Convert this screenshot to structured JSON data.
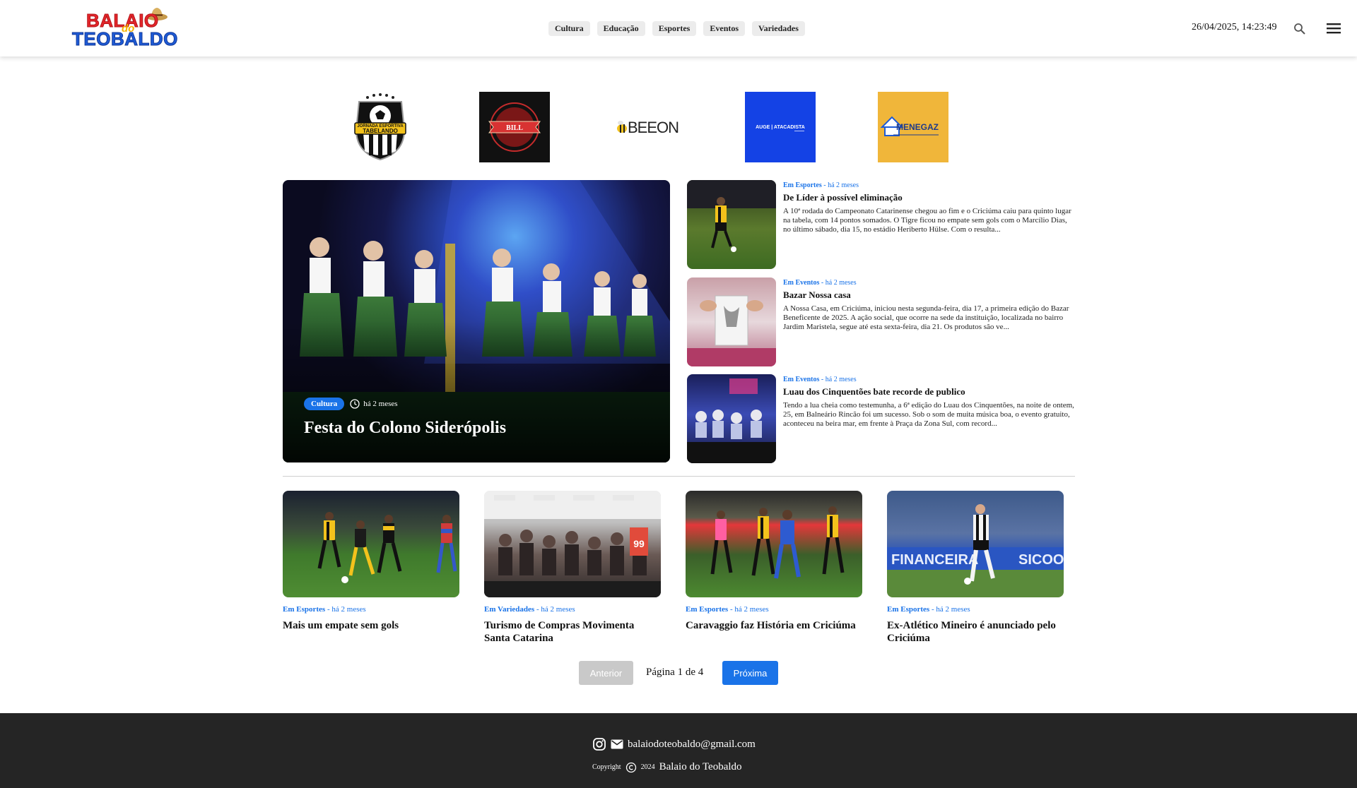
{
  "header": {
    "logo_top": "BALAIO",
    "logo_do": "do",
    "logo_bottom": "TEOBALDO",
    "nav": [
      "Cultura",
      "Educação",
      "Esportes",
      "Eventos",
      "Variedades"
    ],
    "datetime": "26/04/2025, 14:23:49",
    "icons": {
      "search": "search-icon",
      "menu": "menu-icon"
    }
  },
  "sponsors": {
    "tabelando": {
      "line1": "JORNADA ESPORTIVA",
      "line2": "TABELANDO"
    },
    "bill": {
      "name": "BILL"
    },
    "beeon": {
      "name": "BEEON"
    },
    "auge": {
      "name": "AUGE | ATACADISTA"
    },
    "menegaz": {
      "name": "MENEGAZ"
    }
  },
  "featured": {
    "category": "Cultura",
    "time": "há 2 meses",
    "title": "Festa do Colono Siderópolis"
  },
  "side_articles": [
    {
      "prefix": "Em Esportes",
      "time": "há 2 meses",
      "title": "De Líder à possível eliminação",
      "excerpt": "A 10ª rodada do Campeonato Catarinense chegou ao fim e o Criciúma caiu para quinto lugar na tabela, com 14 pontos somados. O Tigre ficou no empate sem gols com o Marcílio Dias, no último sábado, dia 15, no estádio Heriberto Hülse. Com o resulta..."
    },
    {
      "prefix": "Em Eventos",
      "time": "há 2 meses",
      "title": "Bazar Nossa casa",
      "excerpt": "A Nossa Casa, em Criciúma, iniciou nesta segunda-feira, dia 17, a primeira edição do Bazar Beneficente de 2025. A ação social, que ocorre na sede da instituição, localizada no bairro Jardim Maristela, segue até esta sexta-feira, dia 21. Os produtos são ve..."
    },
    {
      "prefix": "Em Eventos",
      "time": "há 2 meses",
      "title": "Luau dos Cinquentões bate recorde de publico",
      "excerpt": "Tendo a lua cheia como testemunha, a 6ª edição do Luau dos Cinquentões, na noite de ontem, 25, em Balneário Rincão foi um sucesso. Sob o som de muita música boa, o evento gratuito, aconteceu na beira mar, em frente à Praça da Zona Sul, com record..."
    }
  ],
  "grid_articles": [
    {
      "prefix": "Em Esportes",
      "time": "há 2 meses",
      "title": "Mais um empate sem gols"
    },
    {
      "prefix": "Em Variedades",
      "time": "há 2 meses",
      "title": "Turismo de Compras Movimenta Santa Catarina",
      "thumb_text": "99"
    },
    {
      "prefix": "Em Esportes",
      "time": "há 2 meses",
      "title": "Caravaggio faz História em Criciúma"
    },
    {
      "prefix": "Em Esportes",
      "time": "há 2 meses",
      "title": "Ex-Atlético Mineiro é anunciado pelo Criciúma",
      "thumb_text_1": "FINANCEIRA",
      "thumb_text_2": "SICOOB"
    }
  ],
  "pagination": {
    "prev": "Anterior",
    "info": "Página 1 de 4",
    "next": "Próxima"
  },
  "footer": {
    "email": "balaiodoteobaldo@gmail.com",
    "copyright_label": "Copyright",
    "year": "2024",
    "brand": "Balaio do Teobaldo"
  },
  "colors": {
    "accent": "#1a73e8",
    "footer_bg": "#252525",
    "logo_red": "#e4262b",
    "logo_blue": "#1e5bd6"
  }
}
